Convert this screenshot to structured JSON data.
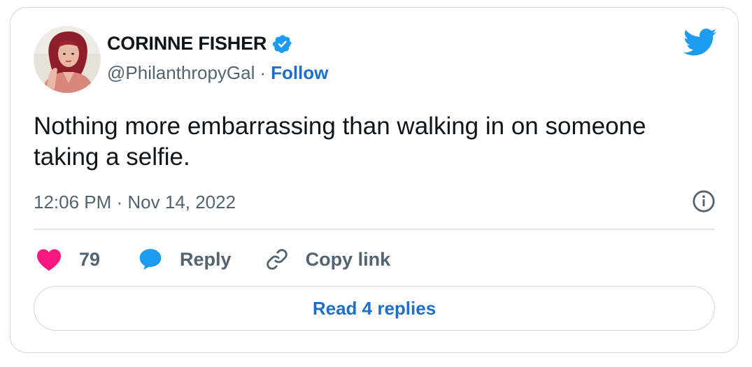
{
  "colors": {
    "accent_blue": "#1d6fcb",
    "twitter_blue": "#1d9bf0",
    "like_pink": "#f91880",
    "secondary_text": "#536471",
    "border": "#cfd9de"
  },
  "author": {
    "name": "CORINNE FISHER",
    "handle": "@PhilanthropyGal",
    "separator": "·",
    "follow_label": "Follow",
    "verified": true,
    "avatar_icon": "profile-photo"
  },
  "tweet": {
    "text": "Nothing more embarrassing than walking in on someone taking a selfie.",
    "timestamp": "12:06 PM · Nov 14, 2022"
  },
  "actions": {
    "like_count": "79",
    "reply_label": "Reply",
    "copy_link_label": "Copy link"
  },
  "footer": {
    "read_replies_label": "Read 4 replies"
  },
  "icons": {
    "logo": "twitter-bird-icon",
    "verified": "verified-badge-icon",
    "info": "info-icon",
    "like": "heart-icon",
    "reply": "speech-bubble-icon",
    "copy": "link-icon"
  }
}
